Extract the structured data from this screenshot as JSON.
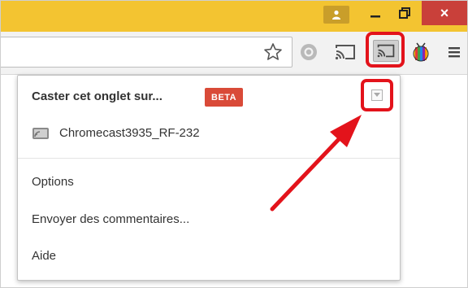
{
  "window": {
    "close_label": "×",
    "icons": [
      "user-icon",
      "minimize-icon",
      "maximize-icon",
      "close-icon"
    ]
  },
  "toolbar": {
    "icons": [
      "star-icon",
      "extension-gray-icon",
      "cast-icon",
      "cast-active-icon",
      "colorful-extension-icon",
      "chrome-menu-icon"
    ]
  },
  "popup": {
    "title": "Caster cet onglet sur...",
    "badge": "BETA",
    "device": "Chromecast3935_RF-232",
    "menu": [
      "Options",
      "Envoyer des commentaires...",
      "Aide"
    ]
  },
  "colors": {
    "titlebar": "#f3c431",
    "highlight": "#e3131b",
    "beta_badge": "#d94a38",
    "close_button": "#c9403a"
  }
}
